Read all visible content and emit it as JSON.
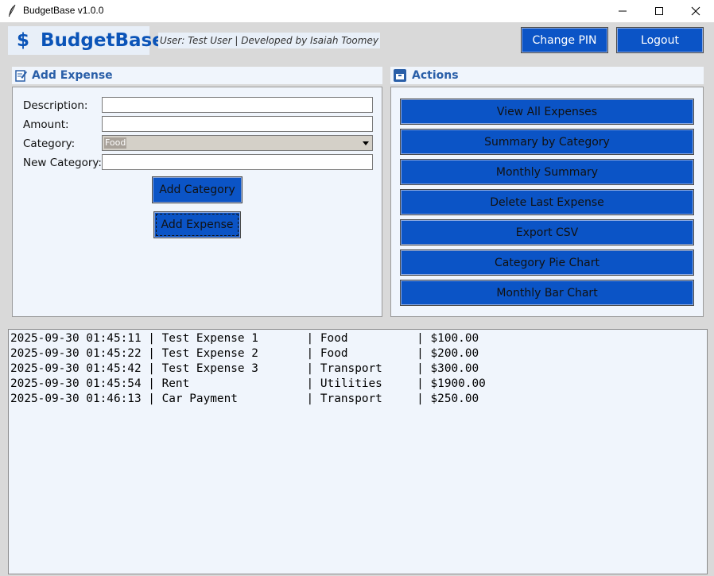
{
  "window": {
    "title": "BudgetBase v1.0.0"
  },
  "header": {
    "dollar_glyph": "$",
    "brand": "BudgetBase",
    "user_info": "User: Test User | Developed by Isaiah Toomey",
    "change_pin_label": "Change PIN",
    "logout_label": "Logout"
  },
  "add_expense": {
    "title": "Add Expense",
    "description_label": "Description:",
    "description_value": "",
    "amount_label": "Amount:",
    "amount_value": "",
    "category_label": "Category:",
    "category_value": "Food",
    "new_category_label": "New Category:",
    "new_category_value": "",
    "add_category_label": "Add Category",
    "add_expense_label": "Add Expense"
  },
  "actions": {
    "title": "Actions",
    "buttons": [
      "View All Expenses",
      "Summary by Category",
      "Monthly Summary",
      "Delete Last Expense",
      "Export CSV",
      "Category Pie Chart",
      "Monthly Bar Chart"
    ]
  },
  "expenses": [
    {
      "timestamp": "2025-09-30 01:45:11",
      "description": "Test Expense 1",
      "category": "Food",
      "amount": "$100.00"
    },
    {
      "timestamp": "2025-09-30 01:45:22",
      "description": "Test Expense 2",
      "category": "Food",
      "amount": "$200.00"
    },
    {
      "timestamp": "2025-09-30 01:45:42",
      "description": "Test Expense 3",
      "category": "Transport",
      "amount": "$300.00"
    },
    {
      "timestamp": "2025-09-30 01:45:54",
      "description": "Rent",
      "category": "Utilities",
      "amount": "$1900.00"
    },
    {
      "timestamp": "2025-09-30 01:46:13",
      "description": "Car Payment",
      "category": "Transport",
      "amount": "$250.00"
    }
  ],
  "colors": {
    "accent": "#0b54c6",
    "brand": "#0b54b8",
    "panel_bg": "#f0f5fc"
  }
}
